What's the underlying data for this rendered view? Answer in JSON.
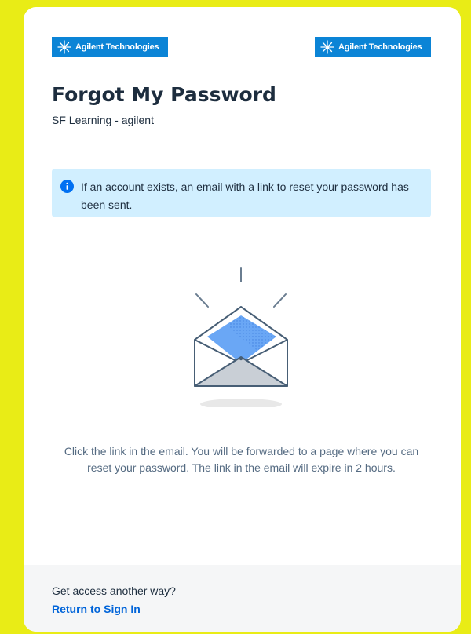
{
  "brand": {
    "logo_text": "Agilent Technologies",
    "logo_color": "#0b84d6"
  },
  "header": {
    "title": "Forgot My Password",
    "subtitle": "SF Learning - agilent"
  },
  "info_banner": {
    "icon": "info-icon",
    "message": "If an account exists, an email with a link to reset your password has been sent."
  },
  "illustration": {
    "icon": "open-envelope-icon"
  },
  "instructions": {
    "text": "Click the link in the email. You will be forwarded to a page where you can reset your password. The link in the email will expire in 2 hours."
  },
  "footer": {
    "prompt": "Get access another way?",
    "link_label": "Return to Sign In"
  },
  "colors": {
    "page_background": "#e9ec16",
    "banner_background": "#d1efff",
    "link": "#0064d9",
    "footer_background": "#f5f6f7"
  }
}
